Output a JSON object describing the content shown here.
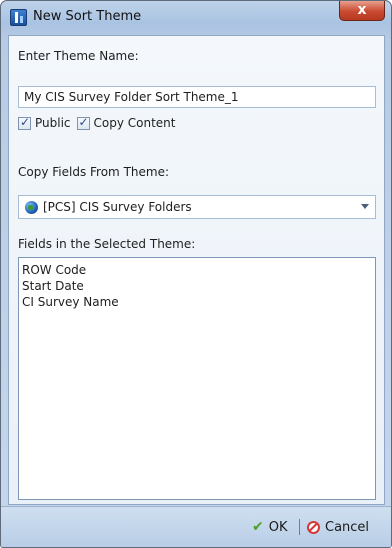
{
  "window": {
    "title": "New Sort Theme",
    "close_symbol": "x"
  },
  "form": {
    "theme_name_label": "Enter Theme Name:",
    "theme_name_value": "My CIS Survey Folder Sort Theme_1",
    "public_label": "Public",
    "public_checked": true,
    "copy_content_label": "Copy Content",
    "copy_content_checked": true,
    "copy_fields_label": "Copy Fields From Theme:",
    "copy_fields_value": "[PCS] CIS Survey Folders",
    "copy_fields_icon": "globe-icon",
    "fields_label": "Fields in the Selected Theme:",
    "fields": [
      "ROW Code",
      "Start Date",
      "CI Survey Name"
    ]
  },
  "footer": {
    "ok_label": "OK",
    "cancel_label": "Cancel",
    "ok_icon": "checkmark-icon",
    "cancel_icon": "cancel-icon"
  }
}
